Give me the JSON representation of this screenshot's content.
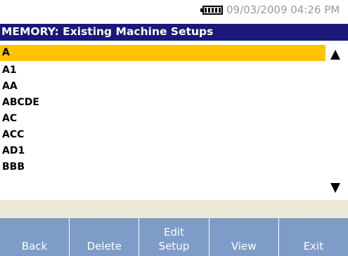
{
  "status": {
    "battery_icon": "battery-full-icon",
    "datetime": "09/03/2009 04:26 PM"
  },
  "title": "MEMORY: Existing Machine Setups",
  "list": {
    "selected_index": 0,
    "selected_color": "#ffc400",
    "items": [
      {
        "label": "A"
      },
      {
        "label": "A1"
      },
      {
        "label": "AA"
      },
      {
        "label": "ABCDE"
      },
      {
        "label": "AC"
      },
      {
        "label": "ACC"
      },
      {
        "label": "AD1"
      },
      {
        "label": "BBB"
      }
    ],
    "scroll_up_icon": "triangle-up-icon",
    "scroll_down_icon": "triangle-down-icon"
  },
  "message": "",
  "softkeys": [
    {
      "label": "Back"
    },
    {
      "label": "Delete"
    },
    {
      "label": "Edit\nSetup"
    },
    {
      "label": "View"
    },
    {
      "label": "Exit"
    }
  ],
  "colors": {
    "title_bar": "#1a1878",
    "softkey_bg": "#7e9cc7",
    "message_bar": "#ece9d8"
  }
}
